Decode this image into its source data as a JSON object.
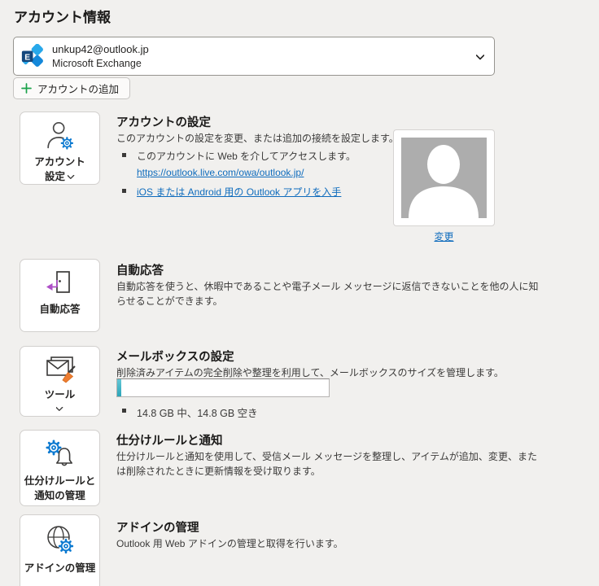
{
  "page": {
    "title": "アカウント情報"
  },
  "account_selector": {
    "email": "unkup42@outlook.jp",
    "provider": "Microsoft Exchange"
  },
  "add_account_label": "アカウントの追加",
  "sections": {
    "account": {
      "tile_line1": "アカウント",
      "tile_line2": "設定",
      "heading": "アカウントの設定",
      "description": "このアカウントの設定を変更、または追加の接続を設定します。",
      "bullet_web_access": "このアカウントに Web を介してアクセスします。",
      "owa_link": "https://outlook.live.com/owa/outlook.jp/",
      "app_link": "iOS または Android 用の Outlook アプリを入手",
      "photo_change_link": "変更"
    },
    "auto_reply": {
      "tile_label": "自動応答",
      "heading": "自動応答",
      "description_line1": "自動応答を使うと、休暇中であることや電子メール メッセージに返信できないことを他の人に知",
      "description_line2": "らせることができます。"
    },
    "mailbox": {
      "tile_label": "ツール",
      "heading": "メールボックスの設定",
      "description": "削除済みアイテムの完全削除や整理を利用して、メールボックスのサイズを管理します。",
      "quota_text": "14.8 GB 中、14.8 GB 空き",
      "quota_fill_percent": 2
    },
    "rules": {
      "tile_line1": "仕分けルールと",
      "tile_line2": "通知の管理",
      "heading": "仕分けルールと通知",
      "description_line1": "仕分けルールと通知を使用して、受信メール メッセージを整理し、アイテムが追加、変更、また",
      "description_line2": "は削除されたときに更新情報を受け取ります。"
    },
    "addins": {
      "tile_label": "アドインの管理",
      "heading": "アドインの管理",
      "description": "Outlook 用 Web アドインの管理と取得を行います。"
    }
  },
  "colors": {
    "link": "#0f6cbd",
    "gear_blue": "#0b79d0",
    "plus_green": "#1aa24a",
    "arrow_purple": "#ae4fc8",
    "broom_orange": "#ed7d31",
    "quota_teal": "#3fb7c7",
    "exchange_navy": "#14477d",
    "exchange_light_blue": "#28a8ea"
  }
}
